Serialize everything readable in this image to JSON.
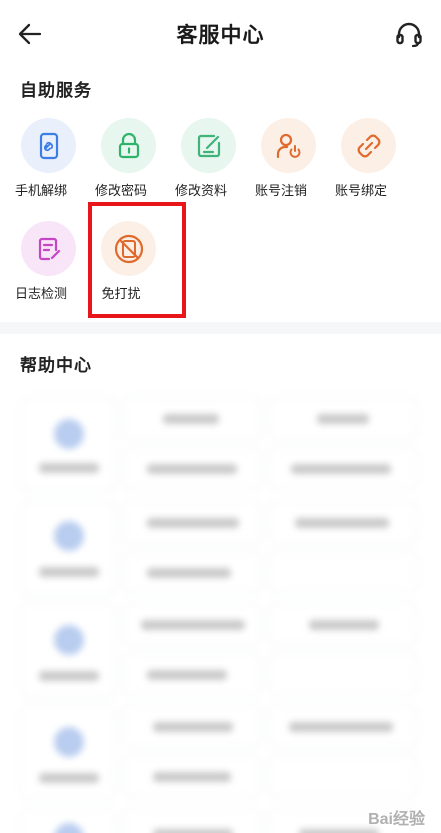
{
  "header": {
    "title": "客服中心",
    "back_icon": "back-arrow-icon",
    "support_icon": "headset-icon"
  },
  "self_service": {
    "title": "自助服务",
    "items": [
      {
        "label": "手机解绑",
        "icon": "phone-unbind-icon",
        "color": "#3c7ee6"
      },
      {
        "label": "修改密码",
        "icon": "lock-icon",
        "color": "#2fb36b"
      },
      {
        "label": "修改资料",
        "icon": "edit-icon",
        "color": "#3eb37a"
      },
      {
        "label": "账号注销",
        "icon": "user-power-icon",
        "color": "#e06a2d"
      },
      {
        "label": "账号绑定",
        "icon": "link-icon",
        "color": "#e06a2d"
      },
      {
        "label": "日志检测",
        "icon": "log-icon",
        "color": "#c645c6"
      },
      {
        "label": "免打扰",
        "icon": "do-not-disturb-icon",
        "color": "#e06a2d"
      }
    ]
  },
  "help_center": {
    "title": "帮助中心"
  },
  "watermark": "Bai经验"
}
